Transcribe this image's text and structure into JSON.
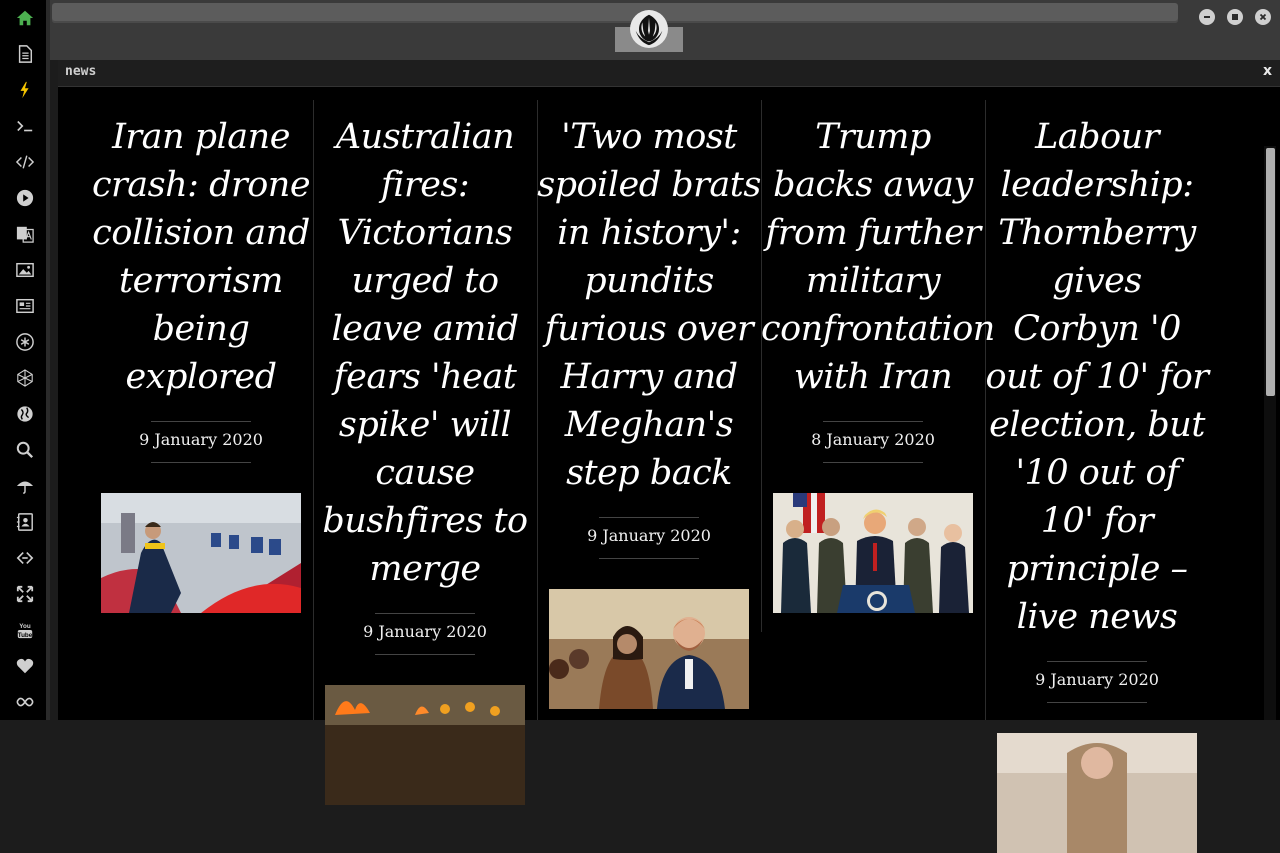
{
  "window": {
    "buttons": [
      {
        "name": "minimize-button",
        "icon": "minimize-icon"
      },
      {
        "name": "maximize-button",
        "icon": "maximize-icon"
      },
      {
        "name": "close-button",
        "icon": "close-icon"
      }
    ]
  },
  "sidebar": {
    "items": [
      {
        "name": "home",
        "icon": "home-icon",
        "color": "#4caf50"
      },
      {
        "name": "document",
        "icon": "document-icon"
      },
      {
        "name": "lightning",
        "icon": "lightning-icon",
        "color": "#f5c400"
      },
      {
        "name": "terminal",
        "icon": "terminal-icon"
      },
      {
        "name": "code",
        "icon": "code-icon"
      },
      {
        "name": "play",
        "icon": "play-icon"
      },
      {
        "name": "translate",
        "icon": "translate-icon"
      },
      {
        "name": "image",
        "icon": "image-icon"
      },
      {
        "name": "news",
        "icon": "newspaper-icon"
      },
      {
        "name": "asterisk",
        "icon": "asterisk-icon"
      },
      {
        "name": "polygon",
        "icon": "polygon-icon"
      },
      {
        "name": "globe",
        "icon": "globe-icon"
      },
      {
        "name": "search",
        "icon": "search-icon"
      },
      {
        "name": "umbrella",
        "icon": "umbrella-icon"
      },
      {
        "name": "contacts",
        "icon": "contact-card-icon"
      },
      {
        "name": "link",
        "icon": "link-icon"
      },
      {
        "name": "expand",
        "icon": "expand-icon"
      },
      {
        "name": "youtube",
        "icon": "youtube-icon"
      },
      {
        "name": "favorites",
        "icon": "heart-icon"
      },
      {
        "name": "infinity",
        "icon": "infinity-icon"
      }
    ]
  },
  "panel": {
    "title": "news",
    "close_label": "x"
  },
  "articles": [
    {
      "headline": "Iran plane crash: drone collision and terrorism being explored",
      "date": "9 January 2020"
    },
    {
      "headline": "Australian fires: Victorians urged to leave amid fears 'heat spike' will cause bushfires to merge",
      "date": "9 January 2020"
    },
    {
      "headline": "'Two most spoiled brats in history': pundits furious over Harry and Meghan's step back",
      "date": "9 January 2020"
    },
    {
      "headline": "Trump backs away from further military confrontation with Iran",
      "date": "8 January 2020"
    },
    {
      "headline": "Labour leadership: Thornberry gives Corbyn '0 out of 10' for election, but '10 out of 10' for principle – live news",
      "date": "9 January 2020"
    }
  ],
  "colors": {
    "background": "#000000",
    "headline": "#ffffff",
    "home_icon": "#4caf50",
    "lightning_icon": "#f5c400"
  }
}
